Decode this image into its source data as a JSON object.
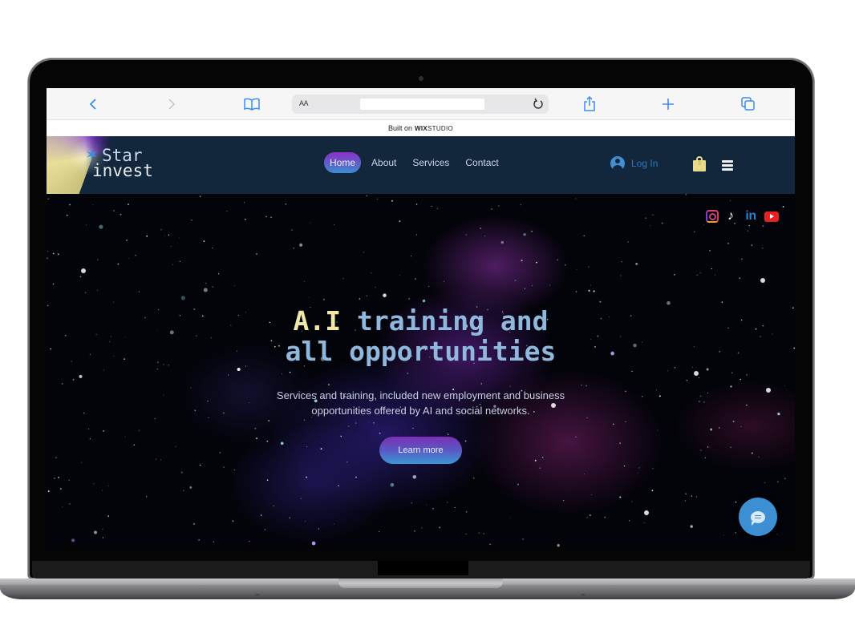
{
  "browser": {
    "back_icon": "chevron-left-icon",
    "forward_icon": "chevron-right-icon",
    "bookmarks_icon": "book-icon",
    "text_size_label": "AA",
    "url_value": "",
    "reload_icon": "reload-icon",
    "share_icon": "share-icon",
    "new_tab_icon": "plus-icon",
    "tabs_icon": "tabs-icon"
  },
  "wix_banner": {
    "prefix": "Built on",
    "brand_bold": "WIX",
    "brand_thin": "STUDIO"
  },
  "header": {
    "logo_line1": "Star",
    "logo_line2": "invest",
    "nav": [
      {
        "label": "Home",
        "active": true
      },
      {
        "label": "About",
        "active": false
      },
      {
        "label": "Services",
        "active": false
      },
      {
        "label": "Contact",
        "active": false
      }
    ],
    "login_label": "Log In",
    "cart_count": "0"
  },
  "social": [
    "instagram-icon",
    "tiktok-icon",
    "linkedin-icon",
    "youtube-icon"
  ],
  "hero": {
    "title_highlight": "A.I",
    "title_rest_line1": " training and",
    "title_line2": "all opportunities",
    "subtitle_line1": "Services and training, included new employment and business",
    "subtitle_line2": "opportunities offered by AI and social networks.",
    "cta_label": "Learn more"
  },
  "colors": {
    "header_bg": "#12273b",
    "accent_purple": "#8b2fc9",
    "accent_blue": "#3b8fd2",
    "title_blue": "#8fb8dc",
    "title_yellow": "#f1e8a8"
  }
}
